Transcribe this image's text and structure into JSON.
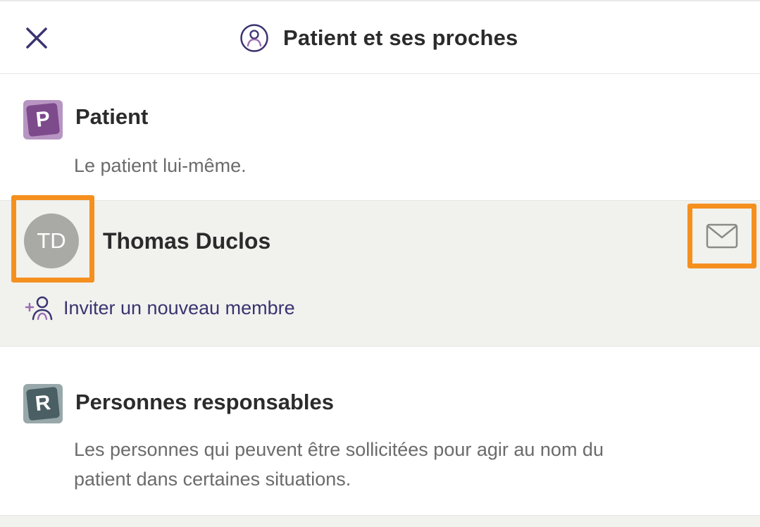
{
  "header": {
    "title": "Patient et ses proches",
    "close_icon": "close-icon",
    "title_icon": "user-circle-icon"
  },
  "patient_section": {
    "badge_letter": "P",
    "badge_color": "#7d4a8c",
    "title": "Patient",
    "description": "Le patient lui-même."
  },
  "members": {
    "items": [
      {
        "initials": "TD",
        "name": "Thomas Duclos",
        "action_icon": "mail-icon"
      }
    ],
    "invite_label": "Inviter un nouveau membre",
    "invite_icon": "add-person-icon"
  },
  "responsables_section": {
    "badge_letter": "R",
    "badge_color": "#4a5f63",
    "title": "Personnes responsables",
    "description_line1": "Les personnes qui peuvent être sollicitées pour agir au nom du",
    "description_line2": "patient dans certaines situations."
  },
  "colors": {
    "accent": "#3a3470",
    "highlight": "#f5901f",
    "member_bg": "#f1f1ee",
    "avatar_bg": "#a9a9a6"
  }
}
